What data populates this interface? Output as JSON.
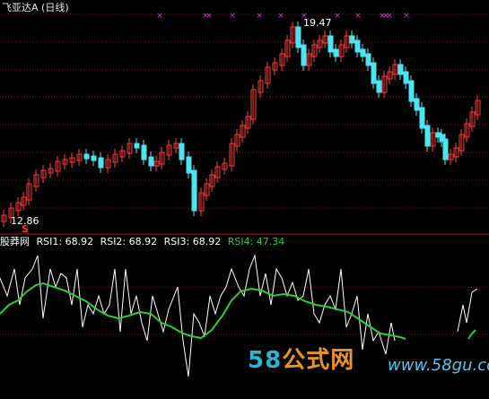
{
  "header": {
    "title": "飞亚达A (日线)"
  },
  "price_panel": {
    "high_label": "19.47",
    "low_label": "12.86",
    "signal_label": "S",
    "cross_marker": "×"
  },
  "indicator_panel": {
    "source": "股莽网",
    "rsi1": "RSI1: 68.92",
    "rsi2": "RSI2: 68.92",
    "rsi3": "RSI3: 68.92",
    "rsi4": "RSI4: 47.34"
  },
  "watermark": {
    "left_a": "58",
    "left_b": "公式网",
    "right": "www.58gu.com"
  },
  "colors": {
    "up": "#ff3a3a",
    "down": "#4fe3f0",
    "grid": "#8a1010",
    "rsi_white": "#ffffff",
    "rsi_green": "#33cc33",
    "marker": "#d040d0"
  }
}
